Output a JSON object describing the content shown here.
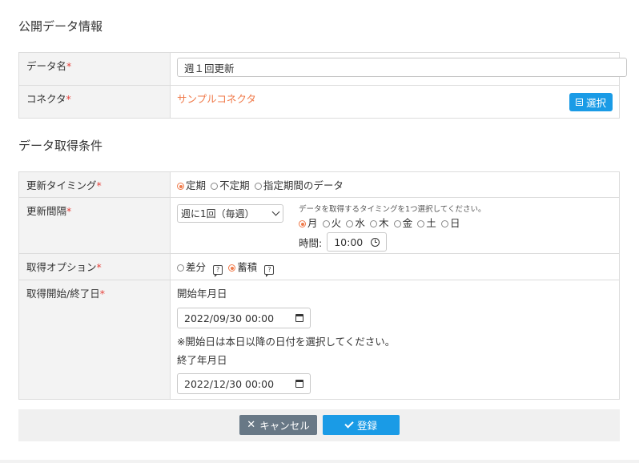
{
  "sections": {
    "public_data": "公開データ情報",
    "acquisition": "データ取得条件"
  },
  "required_mark": "*",
  "fields": {
    "data_name": {
      "label": "データ名",
      "value": "週１回更新"
    },
    "connector": {
      "label": "コネクタ",
      "value": "サンプルコネクタ",
      "select_button": "選択"
    },
    "update_timing": {
      "label": "更新タイミング",
      "options": [
        "定期",
        "不定期",
        "指定期間のデータ"
      ],
      "selected": "定期"
    },
    "update_interval": {
      "label": "更新間隔",
      "select_value": "週に1回（毎週）",
      "hint": "データを取得するタイミングを1つ選択してください。",
      "days": [
        "月",
        "火",
        "水",
        "木",
        "金",
        "土",
        "日"
      ],
      "selected_day": "月",
      "time_label": "時間:",
      "time_value": "10:00"
    },
    "acquisition_option": {
      "label": "取得オプション",
      "options": [
        "差分",
        "蓄積"
      ],
      "selected": "蓄積"
    },
    "period": {
      "label": "取得開始/終了日",
      "start_label": "開始年月日",
      "start_value": "2022/09/30 00:00",
      "note": "※開始日は本日以降の日付を選択してください。",
      "end_label": "終了年月日",
      "end_value": "2022/12/30 00:00"
    }
  },
  "footer": {
    "cancel_label": "キャンセル",
    "register_label": "登録"
  },
  "colors": {
    "accent_blue": "#1a9be6",
    "accent_orange": "#f07a4a",
    "required_red": "#e6423c",
    "cancel_gray": "#687886"
  },
  "icons": [
    "list-icon",
    "clock-icon",
    "help-icon",
    "calendar-icon",
    "close-icon",
    "check-icon"
  ]
}
